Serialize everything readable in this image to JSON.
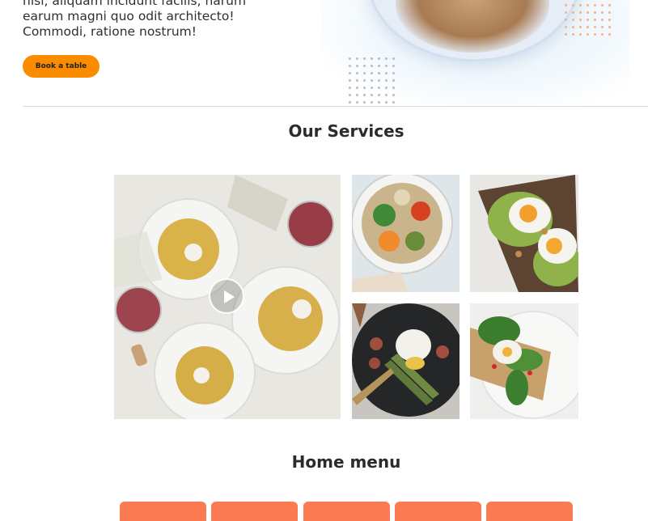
{
  "hero": {
    "text_lines": [
      "nisi, aliquam incidunt facilis, harum",
      "earum magni quo odit architecto!",
      "Commodi, ratione nostrum!"
    ],
    "cta_label": "Book a table"
  },
  "services": {
    "title": "Our Services",
    "video_thumbnail": "pasta-dinner-photo",
    "photos": [
      "salad-bowl-photo",
      "avocado-egg-toast-photo",
      "asparagus-poached-egg-photo",
      "spinach-egg-toast-photo"
    ]
  },
  "home_menu": {
    "title": "Home menu",
    "tab_count_visible": 5
  },
  "colors": {
    "accent_orange": "#fb8c00",
    "menu_tab": "#fc7a51",
    "heading": "#2b2b2b"
  },
  "icons": {
    "play": "play-icon"
  }
}
